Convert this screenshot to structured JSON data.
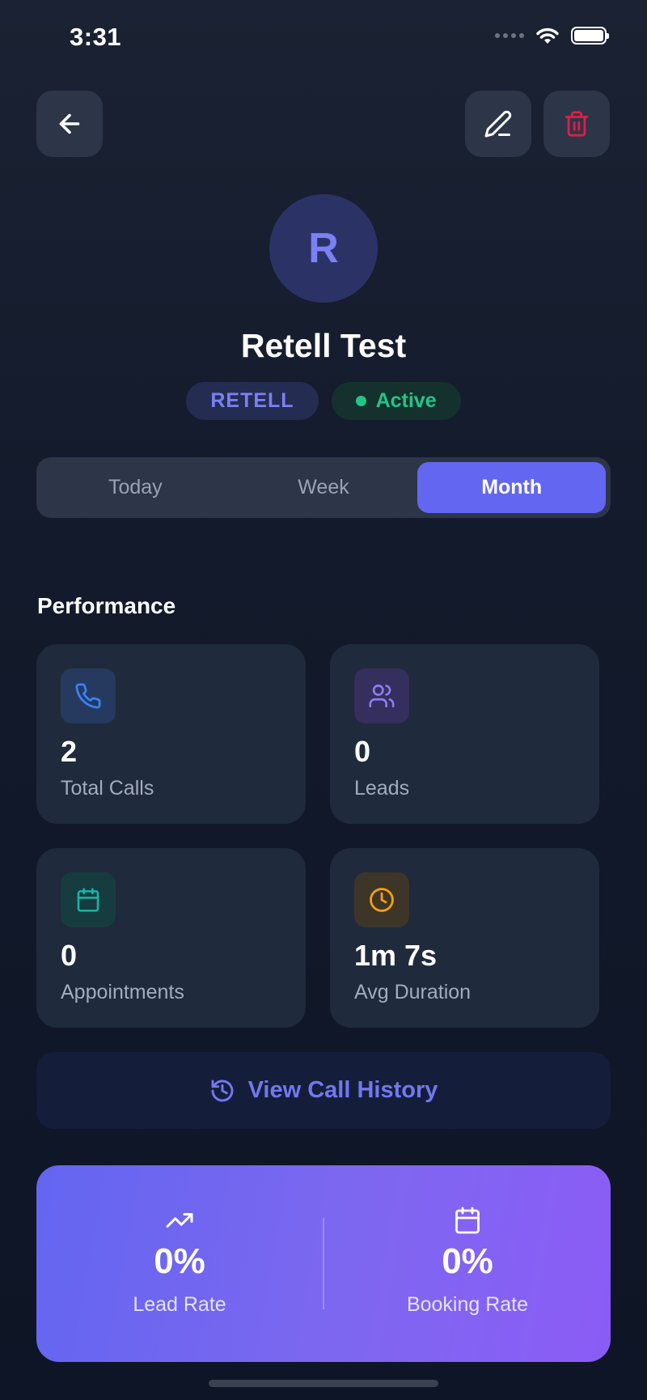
{
  "status_bar": {
    "time": "3:31"
  },
  "header": {
    "back_icon": "arrow-left-icon",
    "edit_icon": "pencil-icon",
    "delete_icon": "trash-icon"
  },
  "agent": {
    "initial": "R",
    "name": "Retell Test",
    "provider_badge": "RETELL",
    "status_badge": "Active"
  },
  "period_tabs": {
    "items": [
      "Today",
      "Week",
      "Month"
    ],
    "selected": "Month"
  },
  "performance": {
    "title": "Performance",
    "stats": [
      {
        "icon": "phone-icon",
        "value": "2",
        "label": "Total Calls"
      },
      {
        "icon": "users-icon",
        "value": "0",
        "label": "Leads"
      },
      {
        "icon": "calendar-icon",
        "value": "0",
        "label": "Appointments"
      },
      {
        "icon": "clock-icon",
        "value": "1m 7s",
        "label": "Avg Duration"
      }
    ]
  },
  "history_button": {
    "label": "View Call History",
    "icon": "history-icon"
  },
  "rates": [
    {
      "icon": "trending-up-icon",
      "value": "0%",
      "label": "Lead Rate"
    },
    {
      "icon": "calendar-icon",
      "value": "0%",
      "label": "Booking Rate"
    }
  ],
  "colors": {
    "accent": "#6366f1",
    "active_green": "#23c587",
    "delete_red": "#e11d48"
  }
}
